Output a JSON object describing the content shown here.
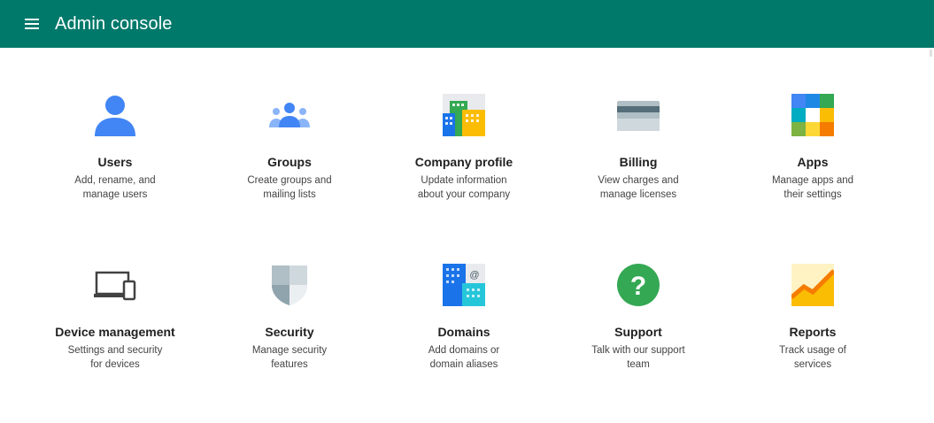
{
  "header": {
    "menu_icon": "hamburger-menu-icon",
    "title": "Admin console",
    "bar_color": "#00796b"
  },
  "tiles": [
    {
      "label": "Users",
      "desc": "Add, rename, and manage users",
      "icon": "user-icon"
    },
    {
      "label": "Groups",
      "desc": "Create groups and mailing lists",
      "icon": "groups-icon"
    },
    {
      "label": "Company profile",
      "desc": "Update information about your company",
      "icon": "building-icon"
    },
    {
      "label": "Billing",
      "desc": "View charges and manage licenses",
      "icon": "credit-card-icon"
    },
    {
      "label": "Apps",
      "desc": "Manage apps and their settings",
      "icon": "apps-grid-icon"
    },
    {
      "label": "Device management",
      "desc": "Settings and security for devices",
      "icon": "devices-icon"
    },
    {
      "label": "Security",
      "desc": "Manage security features",
      "icon": "shield-icon"
    },
    {
      "label": "Domains",
      "desc": "Add domains or domain aliases",
      "icon": "domains-icon"
    },
    {
      "label": "Support",
      "desc": "Talk with our support team",
      "icon": "help-icon"
    },
    {
      "label": "Reports",
      "desc": "Track usage of services",
      "icon": "reports-chart-icon"
    }
  ]
}
